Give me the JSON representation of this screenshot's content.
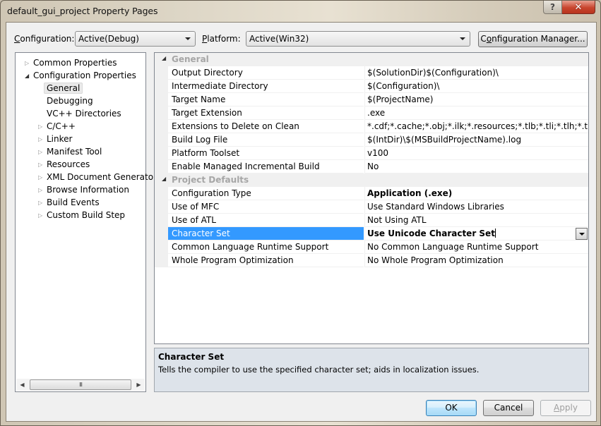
{
  "window": {
    "title": "default_gui_project Property Pages",
    "help_glyph": "?",
    "close_glyph": "✕"
  },
  "toolbar": {
    "configuration_label_accel": "C",
    "configuration_label_rest": "onfiguration:",
    "configuration_value": "Active(Debug)",
    "platform_label_accel": "P",
    "platform_label_rest": "latform:",
    "platform_value": "Active(Win32)",
    "config_manager_pre": "C",
    "config_manager_accel": "o",
    "config_manager_post": "nfiguration Manager..."
  },
  "tree": {
    "items": [
      {
        "label": "Common Properties",
        "level": 0,
        "expander": "collapsed"
      },
      {
        "label": "Configuration Properties",
        "level": 0,
        "expander": "expanded"
      },
      {
        "label": "General",
        "level": 1,
        "expander": "none",
        "selected": true
      },
      {
        "label": "Debugging",
        "level": 1,
        "expander": "none"
      },
      {
        "label": "VC++ Directories",
        "level": 1,
        "expander": "none"
      },
      {
        "label": "C/C++",
        "level": 1,
        "expander": "collapsed"
      },
      {
        "label": "Linker",
        "level": 1,
        "expander": "collapsed"
      },
      {
        "label": "Manifest Tool",
        "level": 1,
        "expander": "collapsed"
      },
      {
        "label": "Resources",
        "level": 1,
        "expander": "collapsed"
      },
      {
        "label": "XML Document Generator",
        "level": 1,
        "expander": "collapsed"
      },
      {
        "label": "Browse Information",
        "level": 1,
        "expander": "collapsed"
      },
      {
        "label": "Build Events",
        "level": 1,
        "expander": "collapsed"
      },
      {
        "label": "Custom Build Step",
        "level": 1,
        "expander": "collapsed"
      }
    ],
    "scrollbar": {
      "left_arrow": "◀",
      "right_arrow": "▶",
      "grip": "III"
    }
  },
  "grid": {
    "categories": [
      {
        "name": "General",
        "properties": [
          {
            "name": "Output Directory",
            "value": "$(SolutionDir)$(Configuration)\\"
          },
          {
            "name": "Intermediate Directory",
            "value": "$(Configuration)\\"
          },
          {
            "name": "Target Name",
            "value": "$(ProjectName)"
          },
          {
            "name": "Target Extension",
            "value": ".exe"
          },
          {
            "name": "Extensions to Delete on Clean",
            "value": "*.cdf;*.cache;*.obj;*.ilk;*.resources;*.tlb;*.tli;*.tlh;*.tmp;*.rsp;*.pgc;*.pgd;*.meta;$(TargetPath)"
          },
          {
            "name": "Build Log File",
            "value": "$(IntDir)\\$(MSBuildProjectName).log"
          },
          {
            "name": "Platform Toolset",
            "value": "v100"
          },
          {
            "name": "Enable Managed Incremental Build",
            "value": "No"
          }
        ]
      },
      {
        "name": "Project Defaults",
        "properties": [
          {
            "name": "Configuration Type",
            "value": "Application (.exe)",
            "bold": true
          },
          {
            "name": "Use of MFC",
            "value": "Use Standard Windows Libraries"
          },
          {
            "name": "Use of ATL",
            "value": "Not Using ATL"
          },
          {
            "name": "Character Set",
            "value": "Use Unicode Character Set",
            "bold": true,
            "selected": true
          },
          {
            "name": "Common Language Runtime Support",
            "value": "No Common Language Runtime Support"
          },
          {
            "name": "Whole Program Optimization",
            "value": "No Whole Program Optimization"
          }
        ]
      }
    ]
  },
  "description": {
    "title": "Character Set",
    "text": "Tells the compiler to use the specified character set; aids in localization issues."
  },
  "buttons": {
    "ok": "OK",
    "cancel": "Cancel",
    "apply_accel": "A",
    "apply_rest": "pply"
  }
}
